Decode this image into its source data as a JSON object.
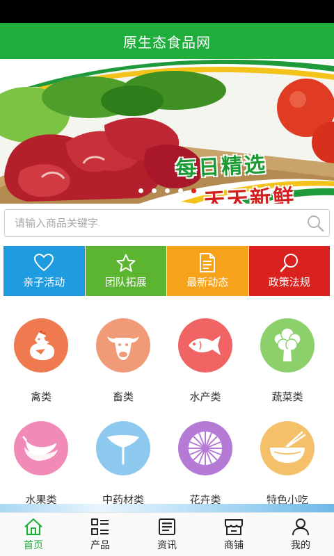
{
  "header": {
    "title": "原生态食品网"
  },
  "banner": {
    "line1": "每日精选",
    "line2": "天天新鲜",
    "slide_count": 5,
    "active_slide": 5
  },
  "search": {
    "placeholder": "请输入商品关键字",
    "value": ""
  },
  "quick_nav": [
    {
      "label": "亲子活动",
      "icon": "heart-icon",
      "color": "#1f9be0"
    },
    {
      "label": "团队拓展",
      "icon": "star-icon",
      "color": "#5cb531"
    },
    {
      "label": "最新动态",
      "icon": "document-icon",
      "color": "#f7a21b"
    },
    {
      "label": "政策法规",
      "icon": "search-icon",
      "color": "#d9211e"
    }
  ],
  "categories": [
    {
      "label": "禽类",
      "icon": "chicken-icon",
      "color": "#f07a4f"
    },
    {
      "label": "畜类",
      "icon": "cow-icon",
      "color": "#f19a77"
    },
    {
      "label": "水产类",
      "icon": "fish-icon",
      "color": "#f06464"
    },
    {
      "label": "蔬菜类",
      "icon": "broccoli-icon",
      "color": "#8bd06a"
    },
    {
      "label": "水果类",
      "icon": "banana-icon",
      "color": "#f28ab8"
    },
    {
      "label": "中药材类",
      "icon": "ginkgo-leaf-icon",
      "color": "#8dc9ee"
    },
    {
      "label": "花卉类",
      "icon": "flower-icon",
      "color": "#b57ad6"
    },
    {
      "label": "特色小吃",
      "icon": "noodle-bowl-icon",
      "color": "#f5c06a"
    }
  ],
  "tabbar": [
    {
      "label": "首页",
      "icon": "home-icon",
      "active": true
    },
    {
      "label": "产品",
      "icon": "grid-list-icon",
      "active": false
    },
    {
      "label": "资讯",
      "icon": "news-icon",
      "active": false
    },
    {
      "label": "商铺",
      "icon": "shop-icon",
      "active": false
    },
    {
      "label": "我的",
      "icon": "user-icon",
      "active": false
    }
  ],
  "colors": {
    "brand": "#1fae3c",
    "active_dot": "#e0271f"
  }
}
